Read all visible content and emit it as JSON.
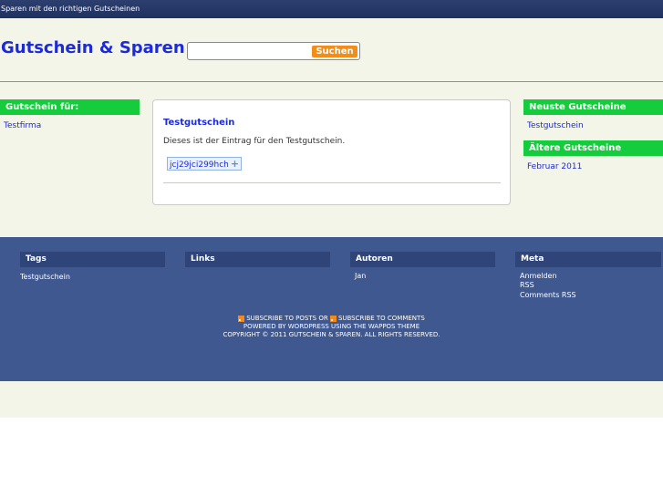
{
  "header": {
    "tagline": "Sparen mit den richtigen Gutscheinen",
    "site_title": "Gutschein & Sparen",
    "search": {
      "placeholder": "",
      "button_label": "Suchen"
    }
  },
  "left_sidebar": {
    "heading": "Gutschein für:",
    "items": [
      "Testfirma"
    ]
  },
  "post": {
    "title": "Testgutschein",
    "text": "Dieses ist der Eintrag für den Testgutschein.",
    "coupon_code": "jcj29jci299hch"
  },
  "right_sidebar": {
    "recent_heading": "Neuste Gutscheine",
    "recent_items": [
      "Testgutschein"
    ],
    "older_heading": "Ältere Gutscheine",
    "older_items": [
      "Februar 2011"
    ]
  },
  "footer": {
    "columns": [
      {
        "heading": "Tags",
        "items": [
          "Testgutschein"
        ]
      },
      {
        "heading": "Links",
        "items": []
      },
      {
        "heading": "Autoren",
        "items": [
          "Jan"
        ]
      },
      {
        "heading": "Meta",
        "items": [
          "Anmelden",
          "RSS",
          "Comments RSS"
        ]
      }
    ],
    "subscribe_posts": "SUBSCRIBE TO POSTS",
    "or": "OR",
    "subscribe_comments": "SUBSCRIBE TO COMMENTS",
    "powered_by": "POWERED BY WORDPRESS USING THE WAPPOS THEME",
    "copyright": "COPYRIGHT © 2011 GUTSCHEIN & SPAREN. ALL RIGHTS RESERVED."
  },
  "colors": {
    "topbar": "#2c3f6e",
    "page_bg": "#f3f5e9",
    "accent_green": "#14cc3c",
    "link_blue": "#1d2bd6",
    "footer_bg": "#3f588f",
    "search_button": "#f28c1b"
  }
}
